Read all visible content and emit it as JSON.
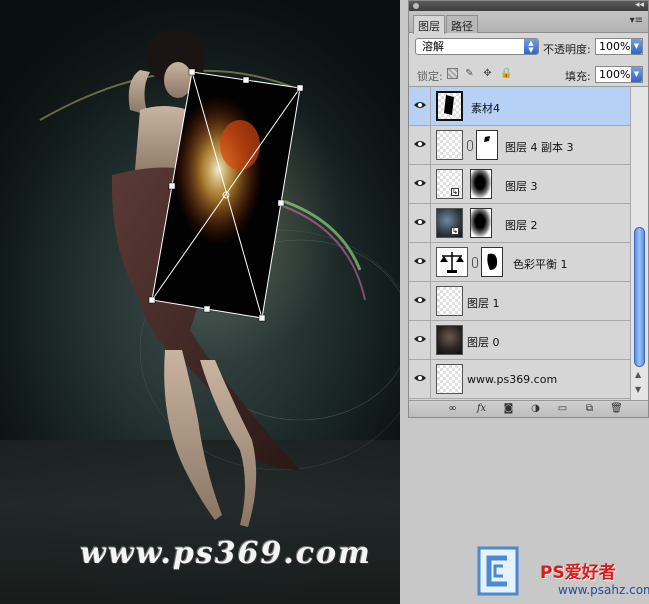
{
  "canvas": {
    "watermark": "www.ps369.com"
  },
  "panel": {
    "tabs": [
      {
        "label": "图层",
        "active": true
      },
      {
        "label": "路径",
        "active": false
      }
    ],
    "menu_icon": "panel-menu-icon",
    "blend_mode": "溶解",
    "opacity_label": "不透明度:",
    "opacity_value": "100%",
    "lock_label": "锁定:",
    "fill_label": "填充:",
    "fill_value": "100%",
    "layers": [
      {
        "name": "素材4",
        "selected": true,
        "visible": true
      },
      {
        "name": "图层 4 副本 3",
        "selected": false,
        "visible": true
      },
      {
        "name": "图层 3",
        "selected": false,
        "visible": true
      },
      {
        "name": "图层 2",
        "selected": false,
        "visible": true
      },
      {
        "name": "色彩平衡 1",
        "selected": false,
        "visible": true
      },
      {
        "name": "图层 1",
        "selected": false,
        "visible": true
      },
      {
        "name": "图层 0",
        "selected": false,
        "visible": true
      },
      {
        "name": "www.ps369.com",
        "selected": false,
        "visible": true
      }
    ],
    "footer_icons": [
      "link-icon",
      "fx-icon",
      "mask-icon",
      "adjustment-icon",
      "group-folder-icon",
      "new-layer-icon",
      "trash-icon"
    ],
    "selection_color": "#b7d0f5"
  },
  "watermark_bottom": {
    "site_name": "PS爱好者",
    "site_url": "www.psahz.com"
  }
}
